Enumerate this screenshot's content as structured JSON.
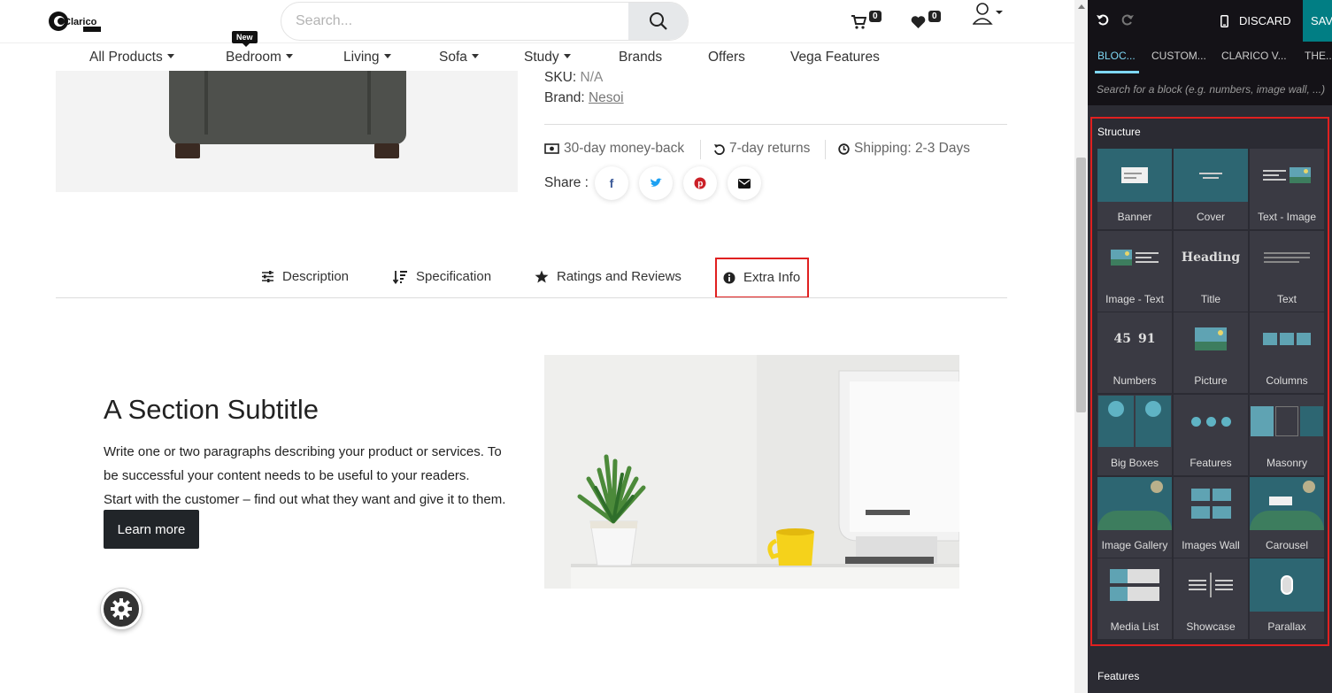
{
  "header": {
    "search_placeholder": "Search...",
    "cart_count": "0",
    "wishlist_count": "0"
  },
  "nav": {
    "new_tag": "New",
    "items": [
      "All Products",
      "Bedroom",
      "Living",
      "Sofa",
      "Study",
      "Brands",
      "Offers",
      "Vega Features"
    ]
  },
  "product": {
    "sku_label": "SKU:",
    "sku_value": "N/A",
    "brand_label": "Brand:",
    "brand_value": "Nesoi",
    "policies": [
      "30-day money-back",
      "7-day returns",
      "Shipping: 2-3 Days"
    ],
    "share_label": "Share :"
  },
  "tabs": [
    "Description",
    "Specification",
    "Ratings and Reviews",
    "Extra Info"
  ],
  "section": {
    "subtitle": "A Section Subtitle",
    "para1": "Write one or two paragraphs describing your product or services. To be successful your content needs to be useful to your readers.",
    "para2": "Start with the customer – find out what they want and give it to them.",
    "button": "Learn more"
  },
  "editor": {
    "discard": "DISCARD",
    "save": "SAV",
    "tabs": [
      "BLOC...",
      "CUSTOM...",
      "CLARICO V...",
      "THE..."
    ],
    "search_placeholder": "Search for a block (e.g. numbers, image wall, ...)",
    "category_structure": "Structure",
    "category_features": "Features",
    "snippets": [
      "Banner",
      "Cover",
      "Text - Image",
      "Image - Text",
      "Title",
      "Text",
      "Numbers",
      "Picture",
      "Columns",
      "Big Boxes",
      "Features",
      "Masonry",
      "Image Gallery",
      "Images Wall",
      "Carousel",
      "Media List",
      "Showcase",
      "Parallax"
    ],
    "title_thumb_text": "Heading",
    "numbers_thumb": [
      "45",
      "91"
    ]
  }
}
